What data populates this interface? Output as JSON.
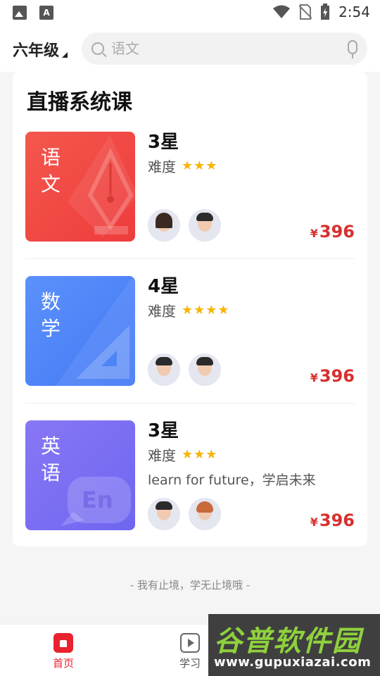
{
  "status_bar": {
    "time": "2:54",
    "left_icons": [
      "image-icon",
      "font-icon"
    ],
    "right_icons": [
      "wifi-icon",
      "no-sim-icon",
      "battery-charging-icon"
    ]
  },
  "header": {
    "grade": "六年级",
    "search_placeholder": "语文"
  },
  "section": {
    "title": "直播系统课"
  },
  "courses": [
    {
      "subject": "语文",
      "stars_title": "3星",
      "difficulty_label": "难度",
      "difficulty_stars": "★★★",
      "slogan": "",
      "currency": "¥",
      "price": "396",
      "cover_color": "#f04a44"
    },
    {
      "subject": "数学",
      "stars_title": "4星",
      "difficulty_label": "难度",
      "difficulty_stars": "★★★★",
      "slogan": "",
      "currency": "¥",
      "price": "396",
      "cover_color": "#4d84f7"
    },
    {
      "subject": "英语",
      "stars_title": "3星",
      "difficulty_label": "难度",
      "difficulty_stars": "★★★",
      "slogan": "learn for future，学启未来",
      "currency": "¥",
      "price": "396",
      "cover_color": "#7b6ff2",
      "cover_badge": "En"
    }
  ],
  "footer_note": "- 我有止境，学无止境哦 -",
  "bottom_nav": {
    "home": "首页",
    "study": "学习"
  },
  "watermark": {
    "title": "谷普软件园",
    "url": "www.gupuxiazai.com"
  },
  "colors": {
    "accent": "#e8232f",
    "price": "#d92f2f",
    "star": "#f7b500"
  }
}
